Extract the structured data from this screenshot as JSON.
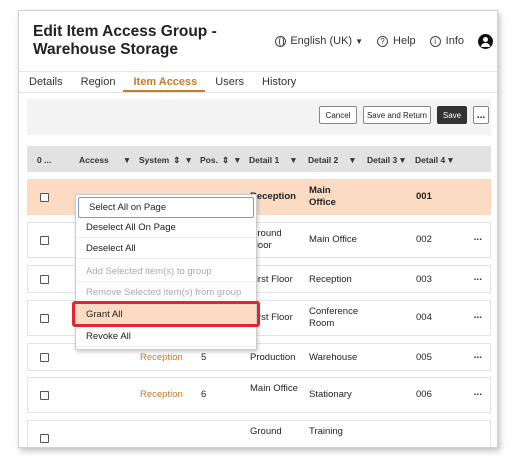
{
  "title": "Edit Item Access Group - Warehouse Storage",
  "header": {
    "language": "English (UK)",
    "help": "Help",
    "info": "Info"
  },
  "tabs": [
    {
      "label": "Details",
      "active": false
    },
    {
      "label": "Region",
      "active": false
    },
    {
      "label": "Item Access",
      "active": true
    },
    {
      "label": "Users",
      "active": false
    },
    {
      "label": "History",
      "active": false
    }
  ],
  "toolbar": {
    "cancel": "Cancel",
    "save_return": "Save and Return",
    "save": "Save",
    "more": "..."
  },
  "table": {
    "select_count": "0",
    "select_dots": "...",
    "columns": [
      "Access",
      "System",
      "Pos.",
      "Detail 1",
      "Detail 2",
      "Detail 3",
      "Detail 4"
    ],
    "rows": [
      {
        "access": "",
        "system": "",
        "pos": "",
        "d1": "Reception",
        "d2": "Main Office",
        "d3": "",
        "d4": "001",
        "selected": true,
        "more": ""
      },
      {
        "access": "",
        "system": "",
        "pos": "",
        "d1": "Ground Floor",
        "d2": "Main Office",
        "d3": "",
        "d4": "002",
        "selected": false,
        "more": "..."
      },
      {
        "access": "",
        "system": "",
        "pos": "",
        "d1": "First Floor",
        "d2": "Reception",
        "d3": "",
        "d4": "003",
        "selected": false,
        "more": "..."
      },
      {
        "access": "",
        "system": "",
        "pos": "",
        "d1": "First Floor",
        "d2": "Conference Room",
        "d3": "",
        "d4": "004",
        "selected": false,
        "more": "..."
      },
      {
        "access": "",
        "system": "Reception",
        "pos": "5",
        "d1": "Production",
        "d2": "Warehouse",
        "d3": "",
        "d4": "005",
        "selected": false,
        "more": "..."
      },
      {
        "access": "",
        "system": "Reception",
        "pos": "6",
        "d1": "Main Office",
        "d2": "Stationary",
        "d3": "",
        "d4": "006",
        "selected": false,
        "more": "..."
      },
      {
        "access": "",
        "system": "",
        "pos": "",
        "d1": "Ground",
        "d2": "Training",
        "d3": "",
        "d4": "",
        "selected": false,
        "more": ""
      }
    ]
  },
  "dropdown": {
    "items": [
      {
        "label": "Select All on Page",
        "disabled": false
      },
      {
        "label": "Deselect All On Page",
        "disabled": false
      },
      {
        "label": "Deselect All",
        "disabled": false
      },
      {
        "label": "Add Selected item(s) to group",
        "disabled": true
      },
      {
        "label": "Remove Selected item(s) from group",
        "disabled": true
      },
      {
        "label": "Grant All",
        "disabled": false
      },
      {
        "label": "Revoke All",
        "disabled": false
      }
    ]
  },
  "colors": {
    "accent": "#c77b2a",
    "selected_row": "#fbdcc3",
    "highlight_border": "#e2252e"
  }
}
